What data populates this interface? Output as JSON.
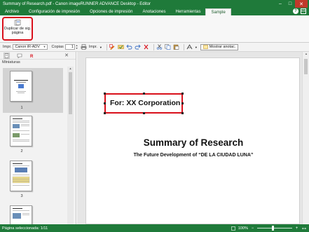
{
  "window": {
    "title": "Summary of Research.pdf - Canon imageRUNNER ADVANCE Desktop - Editor",
    "minimize": "–",
    "maximize": "□",
    "close": "✕"
  },
  "ribbon_tabs": [
    {
      "label": "Archivo",
      "active": false
    },
    {
      "label": "Configuración de impresión",
      "active": false
    },
    {
      "label": "Opciones de impresión",
      "active": false
    },
    {
      "label": "Anotaciones",
      "active": false
    },
    {
      "label": "Herramientas",
      "active": false
    },
    {
      "label": "Sample",
      "active": true
    }
  ],
  "ribbon_right": {
    "help": "?",
    "restore": "▭"
  },
  "ribbon": {
    "duplicate_button": {
      "line1": "Duplicar de sig.",
      "line2": "página"
    }
  },
  "toolbar": {
    "printer_label": "Impr.",
    "printer_value": "Canon iR-ADV",
    "copies_label": "Copias",
    "copies_value": "1",
    "print_label": "Impr.",
    "show_annotations": "Mostrar anotac."
  },
  "left_panel": {
    "header": "Miniaturas",
    "close": "✕",
    "pages": [
      {
        "number": "1",
        "selected": true
      },
      {
        "number": "2",
        "selected": false
      },
      {
        "number": "3",
        "selected": false
      },
      {
        "number": "",
        "selected": false
      }
    ]
  },
  "document": {
    "stamp_text": "For: XX Corporation",
    "title": "Summary of Research",
    "subtitle": "The Future Development of “DE LA CIUDAD LUNA”"
  },
  "status": {
    "selected_text": "Página seleccionada: 1/11",
    "zoom": "100%",
    "zoom_level": 0.45
  },
  "colors": {
    "accent_green": "#1f7a3a",
    "highlight_red": "#d9101b"
  }
}
